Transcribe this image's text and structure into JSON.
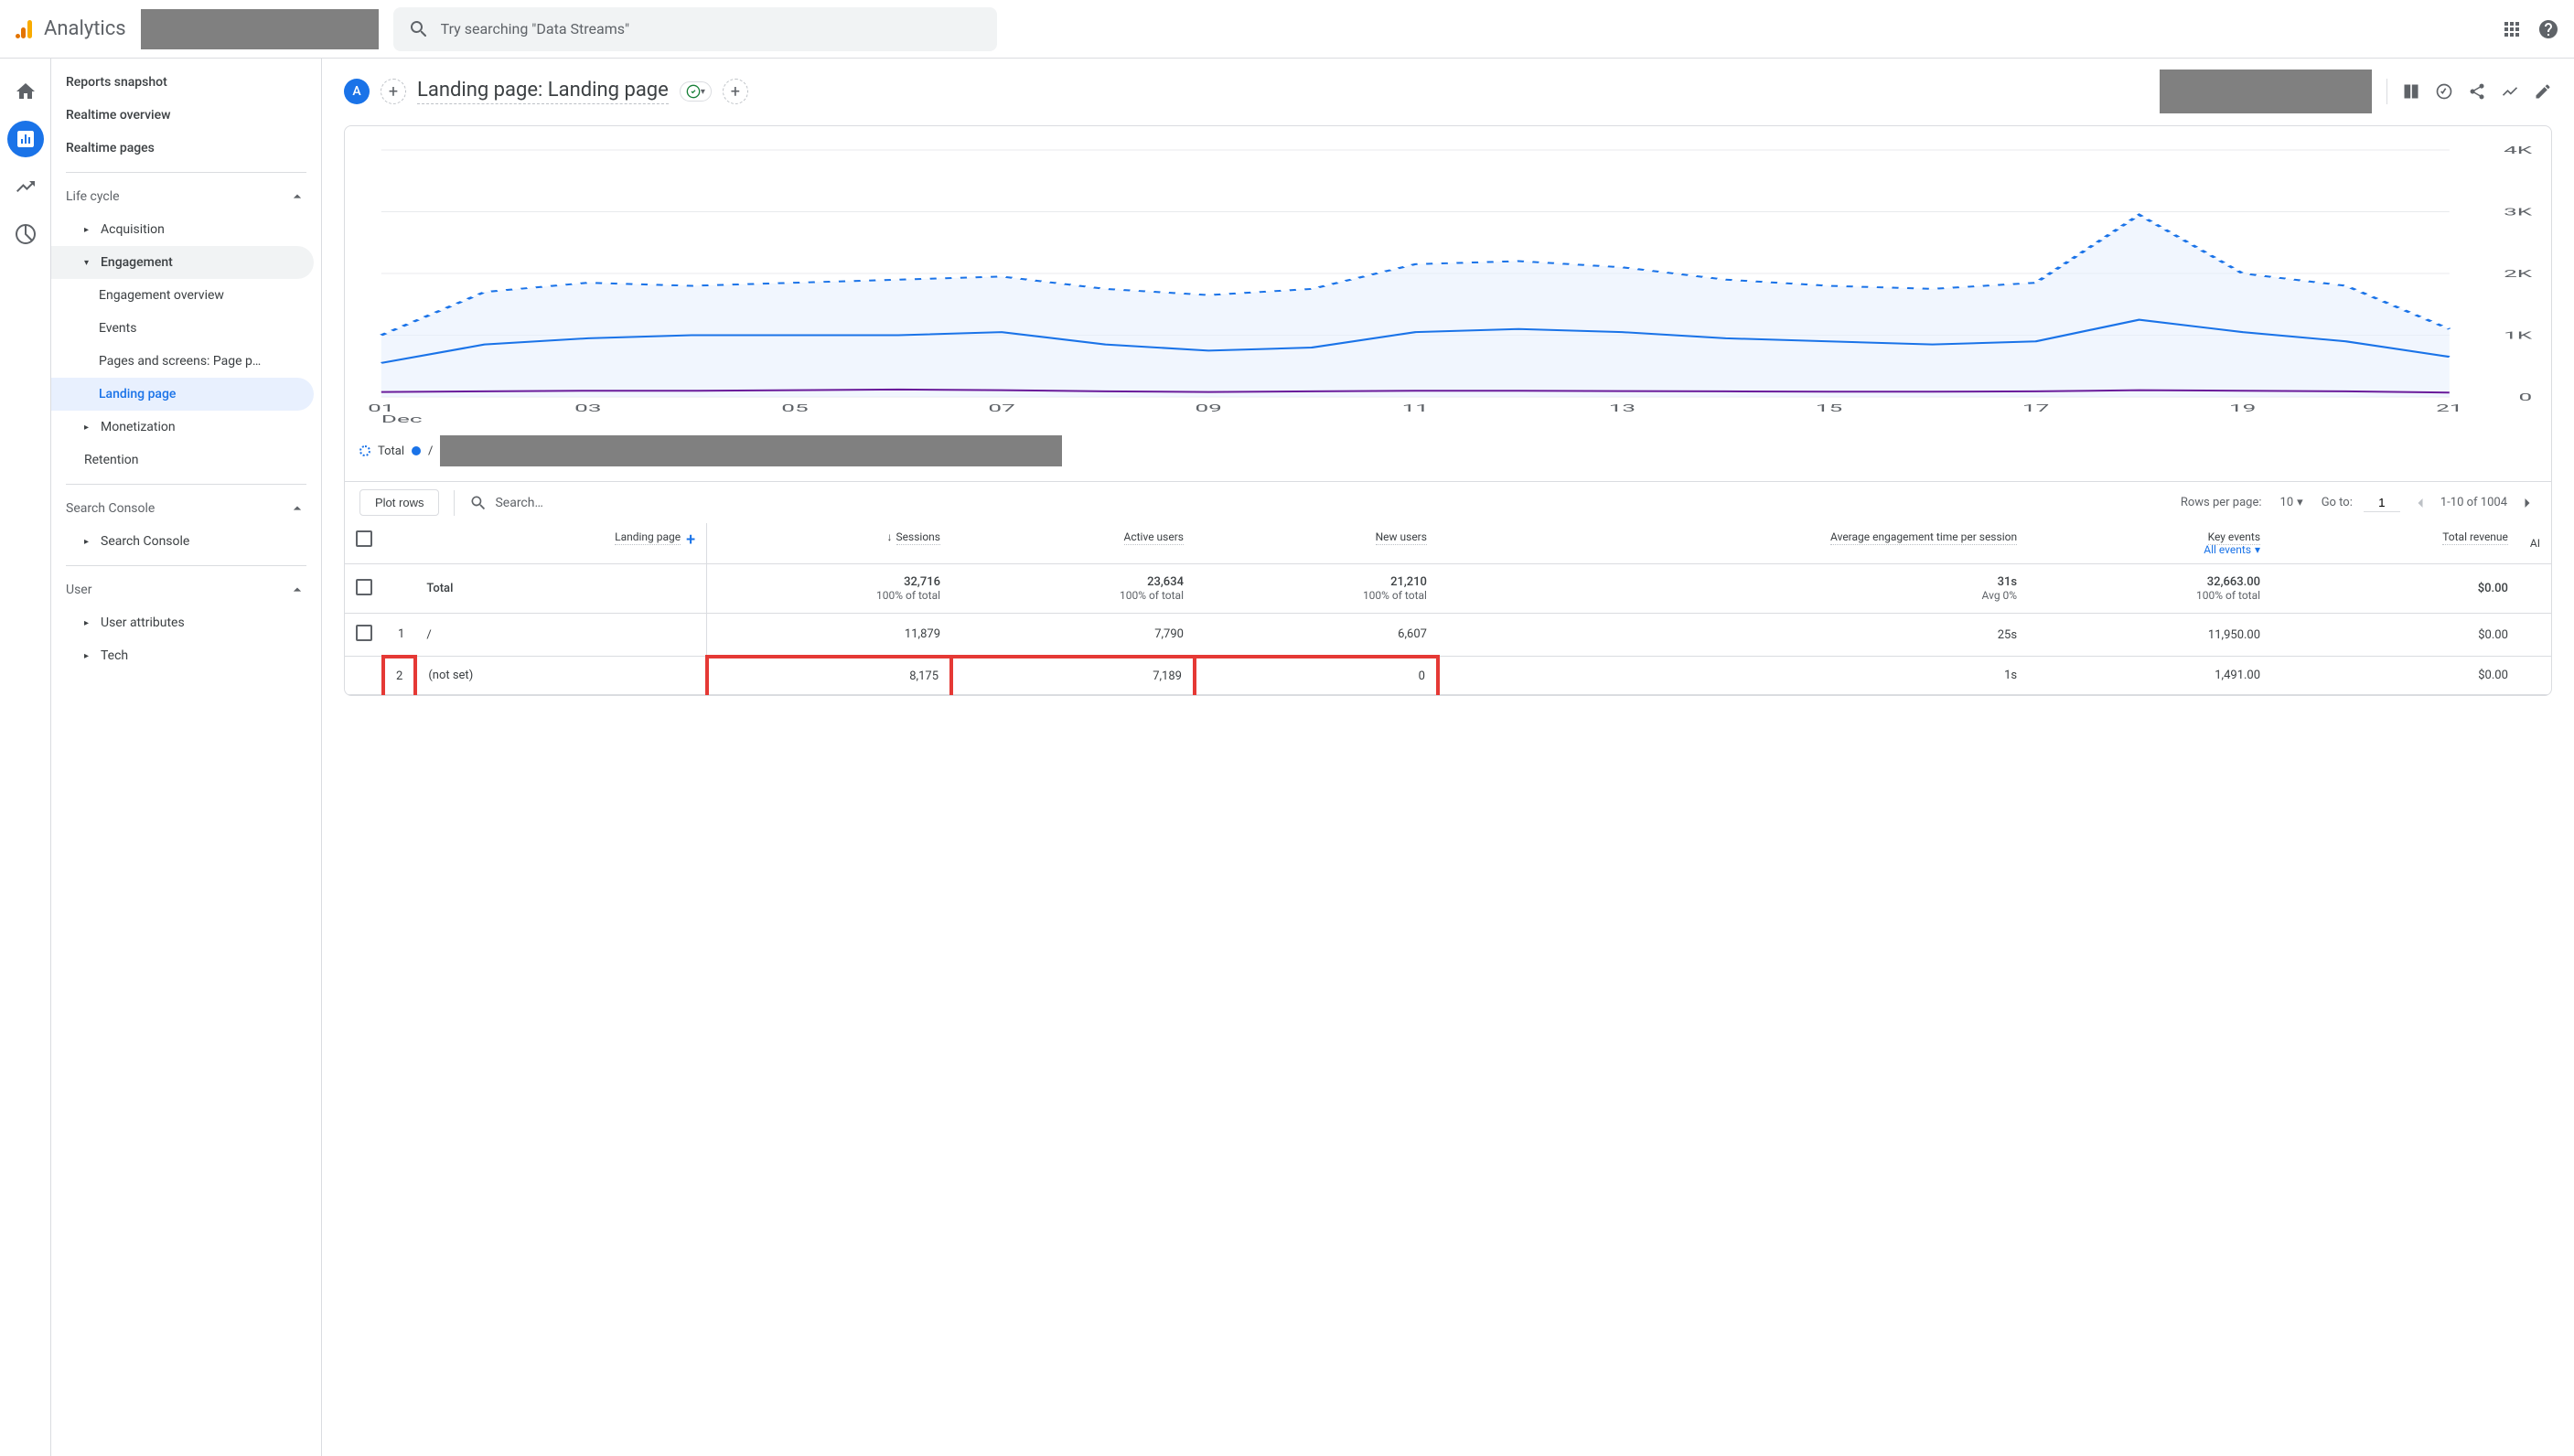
{
  "app_name": "Analytics",
  "search_placeholder": "Try searching \"Data Streams\"",
  "rail": {
    "items": [
      "home",
      "reports",
      "explore",
      "advertising"
    ]
  },
  "sidebar": {
    "top": [
      "Reports snapshot",
      "Realtime overview",
      "Realtime pages"
    ],
    "sections": [
      {
        "label": "Life cycle",
        "expanded": true,
        "items": [
          {
            "label": "Acquisition",
            "expandable": true
          },
          {
            "label": "Engagement",
            "expandable": true,
            "active": true,
            "children": [
              {
                "label": "Engagement overview"
              },
              {
                "label": "Events"
              },
              {
                "label": "Pages and screens: Page p…"
              },
              {
                "label": "Landing page",
                "selected": true
              }
            ]
          },
          {
            "label": "Monetization",
            "expandable": true
          },
          {
            "label": "Retention"
          }
        ]
      },
      {
        "label": "Search Console",
        "expanded": true,
        "items": [
          {
            "label": "Search Console",
            "expandable": true
          }
        ]
      },
      {
        "label": "User",
        "expanded": true,
        "items": [
          {
            "label": "User attributes",
            "expandable": true
          },
          {
            "label": "Tech",
            "expandable": true
          }
        ]
      }
    ]
  },
  "header": {
    "avatar_letter": "A",
    "title": "Landing page: Landing page"
  },
  "chart_data": {
    "type": "line",
    "title": "",
    "xlabel": "Dec",
    "ylabel": "",
    "ylim": [
      0,
      4000
    ],
    "yticks": [
      0,
      1000,
      2000,
      3000,
      4000
    ],
    "ytick_labels": [
      "0",
      "1K",
      "2K",
      "3K",
      "4K"
    ],
    "x": [
      1,
      2,
      3,
      4,
      5,
      6,
      7,
      8,
      9,
      10,
      11,
      12,
      13,
      14,
      15,
      16,
      17,
      18,
      19,
      20,
      21
    ],
    "xtick_labels": [
      "01",
      "03",
      "05",
      "07",
      "09",
      "11",
      "13",
      "15",
      "17",
      "19",
      "21"
    ],
    "series": [
      {
        "name": "Total",
        "style": "dotted",
        "color": "#1a73e8",
        "values": [
          1000,
          1700,
          1850,
          1800,
          1850,
          1900,
          1950,
          1750,
          1650,
          1750,
          2150,
          2200,
          2100,
          1900,
          1800,
          1750,
          1850,
          2950,
          2000,
          1800,
          1100
        ]
      },
      {
        "name": "/",
        "style": "solid",
        "color": "#1a73e8",
        "values": [
          550,
          850,
          950,
          1000,
          1000,
          1000,
          1050,
          850,
          750,
          800,
          1050,
          1100,
          1050,
          950,
          900,
          850,
          900,
          1250,
          1050,
          900,
          650
        ]
      },
      {
        "name": "series2",
        "style": "solid",
        "color": "#6a1b9a",
        "values": [
          80,
          90,
          100,
          100,
          110,
          120,
          110,
          90,
          80,
          90,
          100,
          100,
          95,
          90,
          85,
          85,
          90,
          110,
          100,
          90,
          70
        ]
      }
    ],
    "legend": [
      {
        "label": "Total",
        "style": "dotted"
      },
      {
        "label": "/",
        "style": "dot"
      }
    ]
  },
  "table": {
    "plot_rows_label": "Plot rows",
    "search_placeholder": "Search…",
    "rows_per_page_label": "Rows per page:",
    "rows_per_page_value": "10",
    "goto_label": "Go to:",
    "goto_value": "1",
    "pager_text": "1-10 of 1004",
    "columns": [
      "Landing page",
      "Sessions",
      "Active users",
      "New users",
      "Average engagement time per session",
      "Key events",
      "Total revenue"
    ],
    "key_events_filter": "All events",
    "ai_label": "AI",
    "total_row": {
      "label": "Total",
      "sessions": "32,716",
      "sessions_sub": "100% of total",
      "active_users": "23,634",
      "active_users_sub": "100% of total",
      "new_users": "21,210",
      "new_users_sub": "100% of total",
      "avg_engagement": "31s",
      "avg_engagement_sub": "Avg 0%",
      "key_events": "32,663.00",
      "key_events_sub": "100% of total",
      "revenue": "$0.00"
    },
    "rows": [
      {
        "n": "1",
        "page": "/",
        "sessions": "11,879",
        "active_users": "7,790",
        "new_users": "6,607",
        "avg_engagement": "25s",
        "key_events": "11,950.00",
        "revenue": "$0.00",
        "highlight": false,
        "checkbox": true
      },
      {
        "n": "2",
        "page": "(not set)",
        "sessions": "8,175",
        "active_users": "7,189",
        "new_users": "0",
        "avg_engagement": "1s",
        "key_events": "1,491.00",
        "revenue": "$0.00",
        "highlight": true,
        "checkbox": false
      }
    ]
  }
}
